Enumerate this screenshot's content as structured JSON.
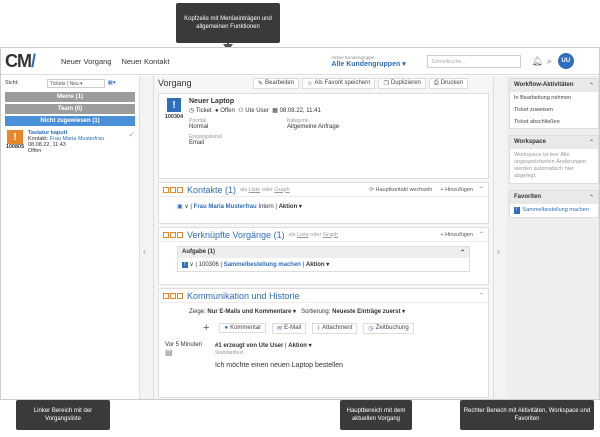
{
  "callouts": {
    "top": "Kopfzeile mit Menüeinträgen und allgemeinen Funktionen",
    "left": "Linker Bereich mit der Vorgangsliste",
    "center": "Hauptbereich mit dem aktuellen Vorgang",
    "right": "Rechter Bereich mit Aktivitäten, Workspace und Favoriten"
  },
  "topbar": {
    "nav_new": "Neuer Vorgang",
    "nav_contact": "Neuer Kontakt",
    "group_label": "Aktive Kundengruppe",
    "group_value": "Alle Kundengruppen",
    "search_placeholder": "Schnellsuche...",
    "avatar": "UU"
  },
  "left": {
    "view_label": "Sicht:",
    "view_value": "Tickets | Neu",
    "groups": [
      {
        "label": "Meine (1)",
        "color": "#9c9c9c"
      },
      {
        "label": "Team (0)",
        "color": "#9c9c9c"
      },
      {
        "label": "Nicht zugewiesen (1)",
        "color": "#4a90d9"
      }
    ],
    "ticket": {
      "number": "100805",
      "title": "Tastatur kaputt",
      "contact_label": "Kontakt:",
      "contact": "Frau Maria Musterfrau",
      "date": "08.08.22, 11:43",
      "status": "Offen"
    }
  },
  "main": {
    "title": "Vorgang",
    "toolbar": {
      "edit": "Bearbeiten",
      "favorite": "Als Favorit speichern",
      "duplicate": "Duplizieren",
      "print": "Drucken"
    },
    "case": {
      "title": "Neuer Laptop",
      "number": "100304",
      "type": "Ticket",
      "status": "Offen",
      "user": "Ute User",
      "date": "08.08.22, 11:41",
      "prio_label": "Priorität",
      "prio": "Normal",
      "cat_label": "Kategorie",
      "cat": "Allgemeine Anfrage",
      "channel_label": "Eingangskanal",
      "channel": "Email"
    },
    "contacts": {
      "title": "Kontakte (1)",
      "tag_prefix": "als",
      "tag_list": "Liste",
      "tag_or": "oder",
      "tag_graph": "Graph",
      "switch": "Hauptkontakt wechseln",
      "add": "Hinzufügen",
      "name": "Frau Maria Musterfrau",
      "role": "Intern",
      "action": "Aktion"
    },
    "linked": {
      "title": "Verknüpfte Vorgänge (1)",
      "add": "Hinzufügen",
      "group": "Aufgabe (1)",
      "num": "100306",
      "name": "Sammelbestellung machen",
      "action": "Aktion"
    },
    "comm": {
      "title": "Kommunikation und Historie",
      "show_label": "Zeige:",
      "show_value": "Nur E-Mails und Kommentare",
      "sort_label": "Sortierung:",
      "sort_value": "Neueste Einträge zuerst",
      "btn_comment": "Kommentar",
      "btn_email": "E-Mail",
      "btn_attach": "Attachment",
      "btn_time": "Zeitbuchung",
      "entry_time": "Vor 5 Minuten",
      "entry_head": "#1 erzeugt von Ute User",
      "entry_action": "Aktion",
      "entry_sub": "Standardtext",
      "entry_text": "Ich möchte einen neuen Laptop bestellen"
    }
  },
  "right": {
    "workflow_title": "Workflow-Aktivitäten",
    "workflow_items": [
      "In Bearbeitung nehmen",
      "Ticket zuweisen",
      "Ticket abschließen"
    ],
    "workspace_title": "Workspace",
    "workspace_text": "Workspace ist leer Alle ungespeicherten Änderungen werden automatisch hier abgelegt.",
    "fav_title": "Favoriten",
    "fav_item": "Sammelbestellung machen"
  }
}
